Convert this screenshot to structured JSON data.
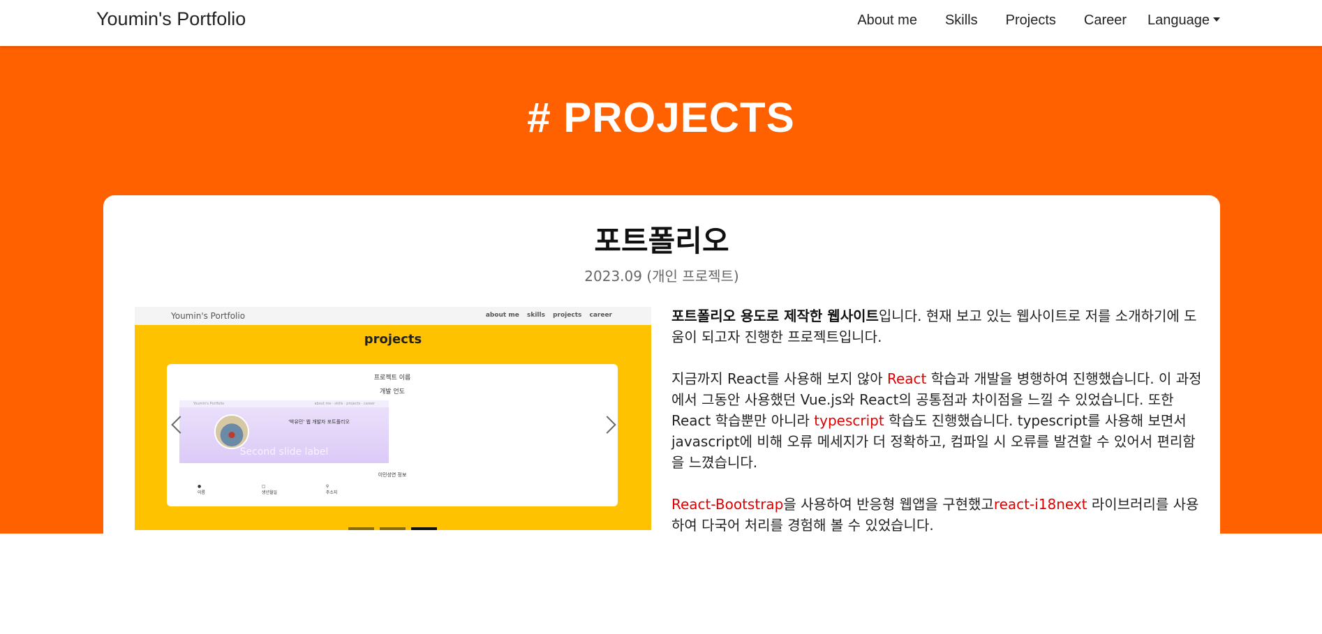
{
  "nav": {
    "brand": "Youmin's Portfolio",
    "links": [
      "About me",
      "Skills",
      "Projects",
      "Career",
      "Language"
    ]
  },
  "section": {
    "title": "# PROJECTS"
  },
  "project": {
    "title": "포트폴리오",
    "date": "2023.09 (개인 프로젝트)",
    "screenshot": {
      "brand": "Youmin's Portfolio",
      "links": [
        "about me",
        "skills",
        "projects",
        "career"
      ],
      "heading": "projects",
      "card_title": "프로젝트 이름",
      "card_purpose": "개발 언도",
      "inner_brand": "Youmin's Portfolio",
      "inner_links": "about me · skills · projects · career",
      "intro": "'박유민' 웹 개발자 포트폴리오",
      "slide_label": "Second slide label",
      "sub_heading": "이민성연 정보",
      "icon_items": [
        "이름",
        "생년월일",
        "주소지"
      ],
      "indicator_count": 3,
      "active_indicator": 3
    },
    "description": {
      "p1": {
        "bold": "포트폴리오 용도로 제작한 웹사이트",
        "rest": "입니다. 현재 보고 있는 웹사이트로 저를 소개하기에 도움이 되고자 진행한 프로젝트입니다."
      },
      "p2": {
        "a": "지금까지 React를 사용해 보지 않아 ",
        "red1": "React",
        "b": " 학습과 개발을 병행하여 진행했습니다. 이 과정에서 그동안 사용했던 Vue.js와 React의 공통점과 차이점을 느낄 수 있었습니다. 또한 React 학습뿐만 아니라 ",
        "red2": "typescript",
        "c": " 학습도 진행했습니다. typescript를 사용해 보면서 javascript에 비해 오류 메세지가 더 정확하고, 컴파일 시 오류를 발견할 수 있어서 편리함을 느꼈습니다."
      },
      "p3": {
        "red1": "React-Bootstrap",
        "a": "을 사용하여 반응형 웹앱을 구현했고",
        "red2": "react-i18next",
        "b": " 라이브러리를 사용하여 다국어 처리를 경험해 볼 수 있었습니다."
      }
    }
  },
  "colors": {
    "section_bg": "#ff6000",
    "screenshot_bg": "#ffc200",
    "highlight": "#e00000"
  }
}
